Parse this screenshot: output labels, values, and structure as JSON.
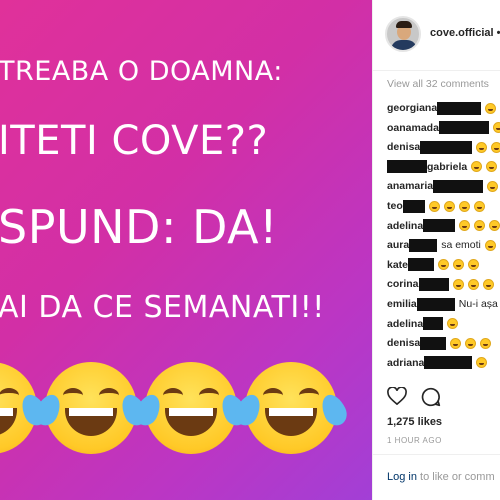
{
  "post": {
    "lines": [
      "TREABA O DOAMNA:",
      "ITETI COVE??",
      "SPUND: DA!",
      "AI DA CE SEMANATI!!"
    ],
    "emoji_name": "face-with-tears-of-joy"
  },
  "header": {
    "username": "cove.official",
    "separator": "•"
  },
  "comments": {
    "view_all": "View all 32 comments",
    "items": [
      {
        "user": "georgiana",
        "text": "",
        "emojis": 1
      },
      {
        "user": "oanamada",
        "text": "",
        "emojis": 1
      },
      {
        "user": "denisa",
        "text": "",
        "emojis": 2
      },
      {
        "user": "gabriela",
        "text": "",
        "emojis": 2
      },
      {
        "user": "anamaria",
        "text": "",
        "emojis": 1
      },
      {
        "user": "teo",
        "text": "",
        "emojis": 4
      },
      {
        "user": "adelina",
        "text": "",
        "emojis": 4
      },
      {
        "user": "aura",
        "text": "sa emoti",
        "emojis": 1
      },
      {
        "user": "kate",
        "text": "",
        "emojis": 3
      },
      {
        "user": "corina",
        "text": "",
        "emojis": 3
      },
      {
        "user": "emilia",
        "text": "Nu-i așa",
        "emojis": 0
      },
      {
        "user": "adelina",
        "text": "",
        "emojis": 1
      },
      {
        "user": "denisa",
        "text": "",
        "emojis": 3
      },
      {
        "user": "adriana",
        "text": "",
        "emojis": 1
      }
    ]
  },
  "stats": {
    "likes": "1,275 likes",
    "time": "1 HOUR AGO"
  },
  "footer": {
    "login": "Log in",
    "rest": " to like or comm"
  },
  "colors": {
    "gradient_start": "#e0319a",
    "gradient_end": "#a23fd6"
  }
}
